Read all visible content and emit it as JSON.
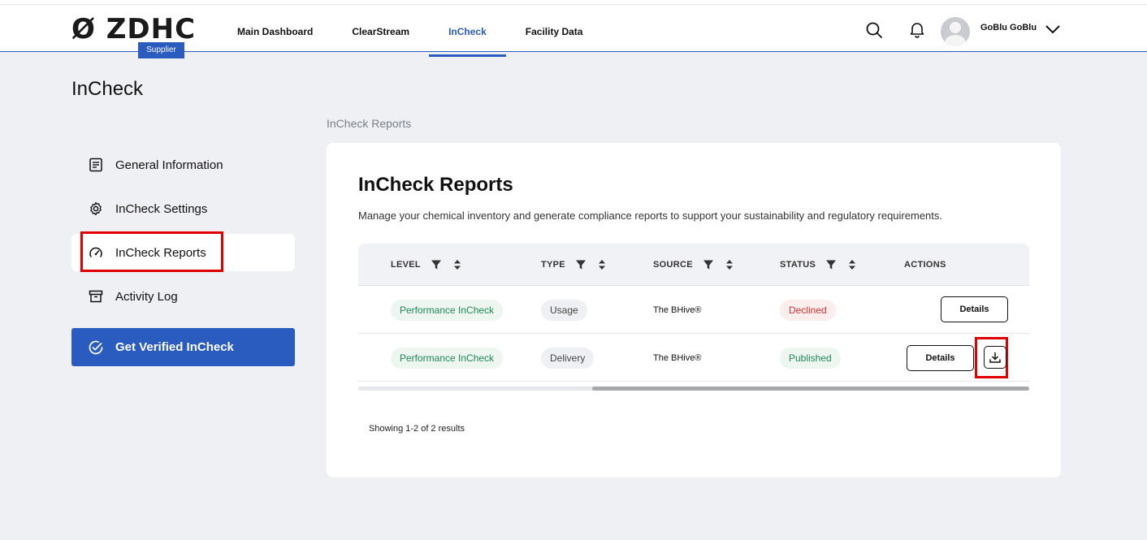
{
  "header": {
    "logo": "ZDHC",
    "badge": "Supplier",
    "nav": [
      "Main Dashboard",
      "ClearStream",
      "InCheck",
      "Facility Data"
    ],
    "active_nav": "InCheck",
    "icons": [
      "search-icon",
      "bell-icon"
    ],
    "username": "GoBlu GoBlu"
  },
  "page": {
    "title": "InCheck",
    "breadcrumb": "InCheck Reports"
  },
  "sidebar": {
    "items": [
      {
        "label": "General Information",
        "icon": "document-list-icon"
      },
      {
        "label": "InCheck Settings",
        "icon": "gear-icon"
      },
      {
        "label": "InCheck Reports",
        "icon": "gauge-icon"
      },
      {
        "label": "Activity Log",
        "icon": "archive-box-icon"
      }
    ],
    "active": "InCheck Reports",
    "cta": "Get Verified InCheck"
  },
  "card": {
    "title": "InCheck Reports",
    "description": "Manage your chemical inventory and generate compliance reports to support your sustainability and regulatory requirements.",
    "columns": [
      "LEVEL",
      "TYPE",
      "SOURCE",
      "STATUS",
      "ACTIONS"
    ],
    "rows": [
      {
        "level": "Performance InCheck",
        "type": "Usage",
        "source": "The BHive®",
        "status": "Declined",
        "details": "Details"
      },
      {
        "level": "Performance InCheck",
        "type": "Delivery",
        "source": "The BHive®",
        "status": "Published",
        "details": "Details"
      }
    ],
    "showing": "Showing 1-2 of 2 results"
  },
  "colors": {
    "accent": "#2a5bbf",
    "highlight": "#e00000",
    "success": "#1d8a52",
    "danger": "#d0312d"
  }
}
